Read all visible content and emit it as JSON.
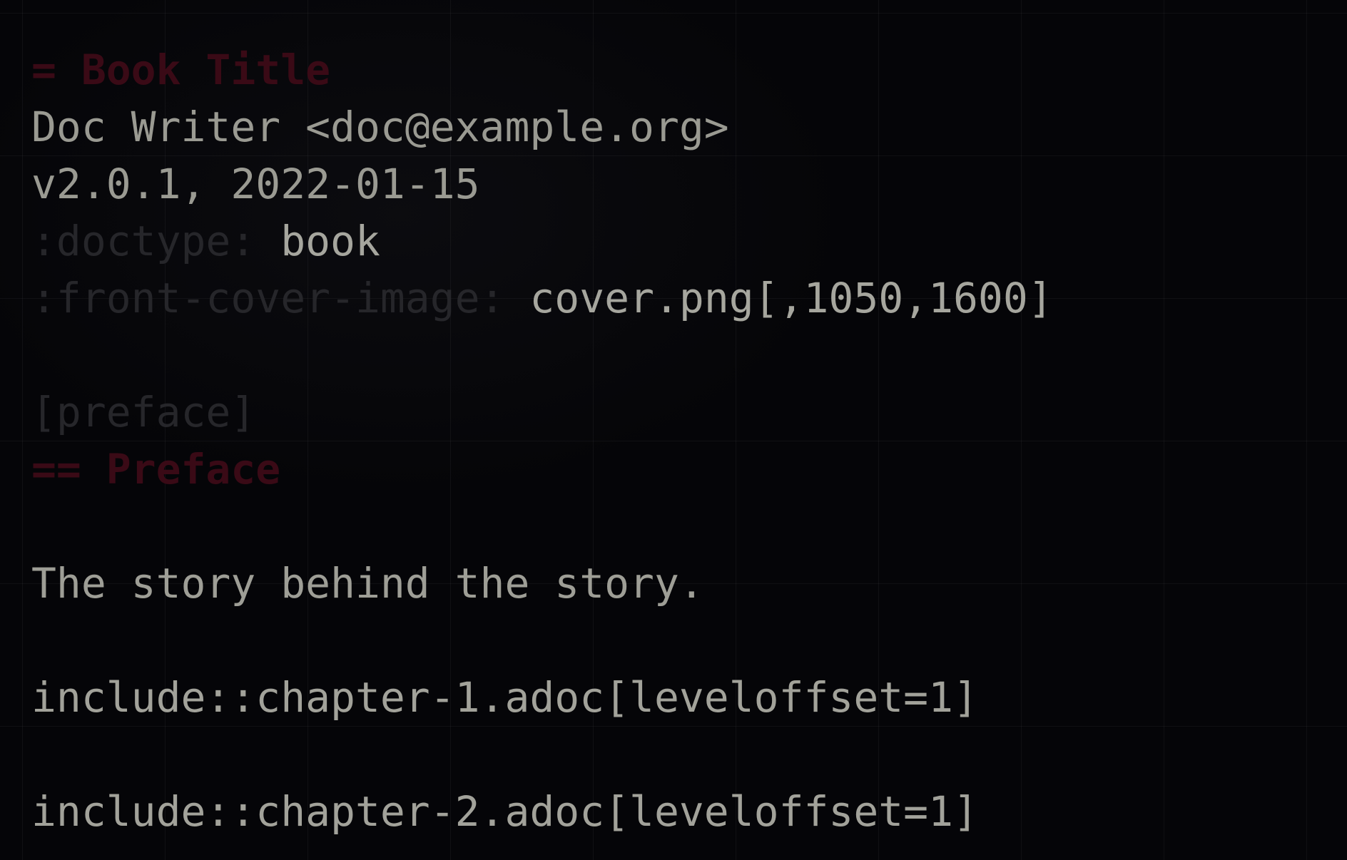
{
  "editor": {
    "lines": {
      "title": "= Book Title",
      "author": "Doc Writer <doc@example.org>",
      "revision": "v2.0.1, 2022-01-15",
      "doctype_attr": ":doctype:",
      "doctype_value": " book",
      "cover_attr": ":front-cover-image:",
      "cover_value": " cover.png[,1050,1600]",
      "blank_1": "",
      "style_block": "[preface]",
      "preface_heading": "== Preface",
      "blank_2": "",
      "preface_text": "The story behind the story.",
      "blank_3": "",
      "include_1": "include::chapter-1.adoc[leveloffset=1]",
      "blank_4": "",
      "include_2": "include::chapter-2.adoc[leveloffset=1]"
    }
  },
  "colors": {
    "background": "#050508",
    "heading": "#3a0a16",
    "attribute": "#26262a",
    "text": "#9e9e96"
  }
}
